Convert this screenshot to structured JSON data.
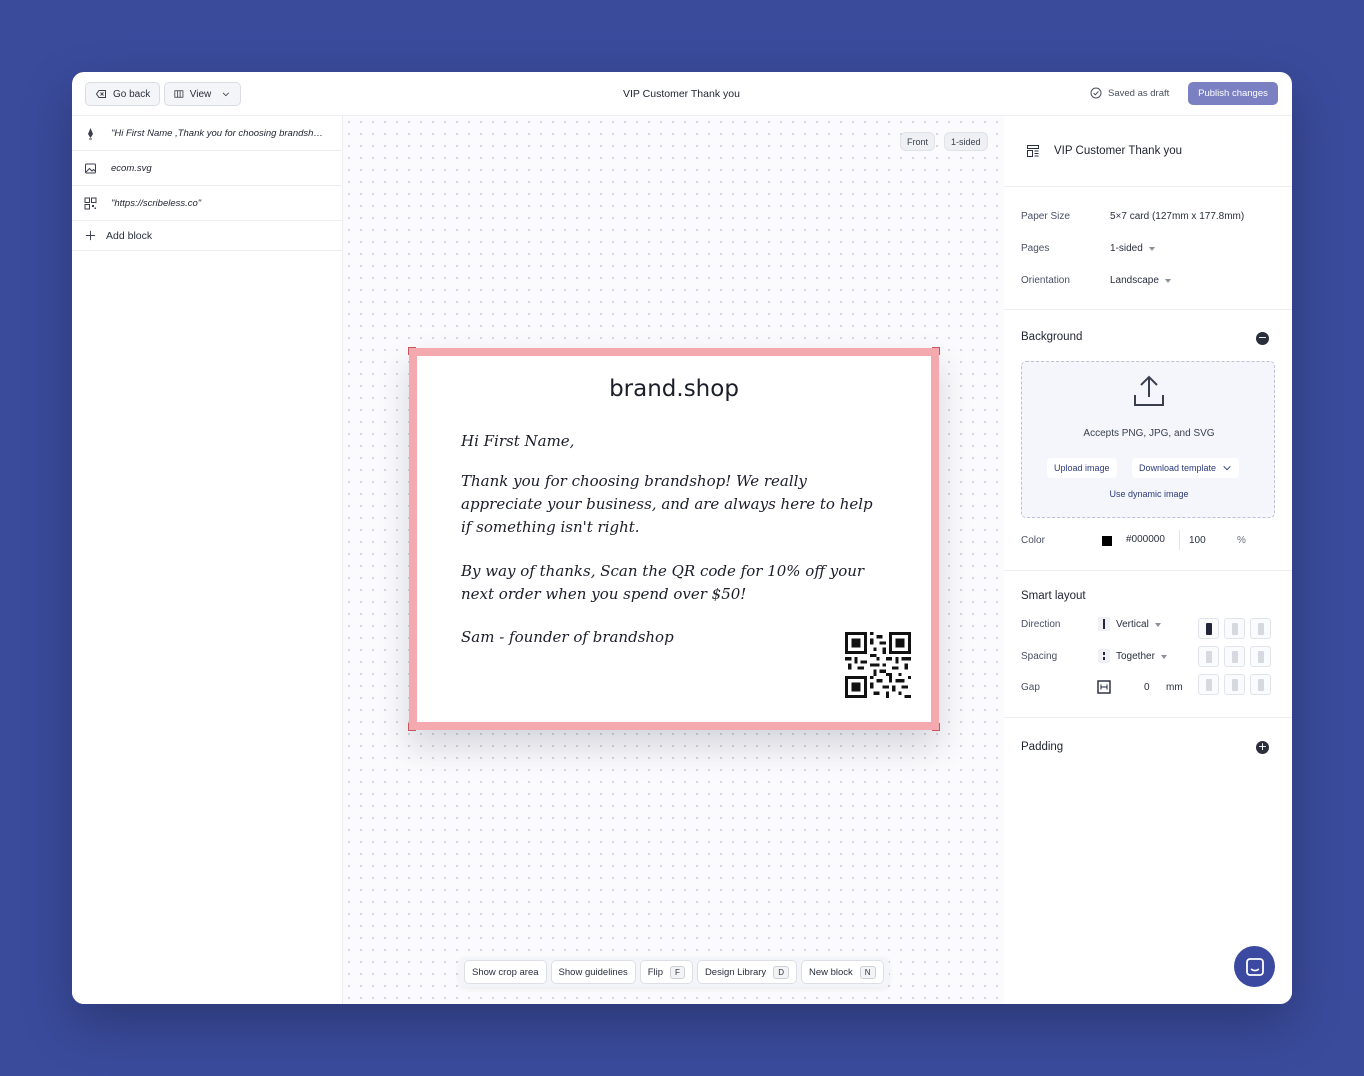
{
  "topbar": {
    "back_label": "Go back",
    "view_label": "View",
    "title": "VIP Customer Thank you",
    "saved_status": "Saved as draft",
    "publish_label": "Publish changes"
  },
  "blocks": {
    "items": [
      {
        "label": "\"Hi First Name ,Thank you for choosing brandshop! We really appreciate your business\"",
        "icon": "pen-icon"
      },
      {
        "label": "ecom.svg",
        "icon": "image-icon"
      },
      {
        "label": "\"https://scribeless.co\"",
        "icon": "qr-icon"
      }
    ],
    "add_label": "Add block"
  },
  "canvas": {
    "side_label": "Front",
    "sided_label": "1-sided",
    "card": {
      "brand": "brand.shop",
      "greeting": "Hi First Name,",
      "para1": "Thank you for choosing brandshop! We really appreciate your business, and are always here to help if something isn't right.",
      "para2": "By way of thanks, Scan the QR code for 10% off your next order when you spend over $50!",
      "signoff": "Sam - founder of brandshop",
      "border_color": "#f3a9ad"
    },
    "toolbar": {
      "crop": "Show crop area",
      "guidelines": "Show guidelines",
      "flip": "Flip",
      "flip_key": "F",
      "library": "Design Library",
      "library_key": "D",
      "new_block": "New block",
      "new_block_key": "N"
    }
  },
  "settings": {
    "title": "VIP Customer Thank you",
    "paper_size_label": "Paper Size",
    "paper_size_value": "5×7 card (127mm x 177.8mm)",
    "pages_label": "Pages",
    "pages_value": "1-sided",
    "orientation_label": "Orientation",
    "orientation_value": "Landscape",
    "background": {
      "title": "Background",
      "accepts": "Accepts PNG, JPG, and SVG",
      "upload": "Upload image",
      "download": "Download template",
      "dynamic": "Use dynamic image",
      "color_label": "Color",
      "color_value": "#000000",
      "opacity": "100",
      "opacity_unit": "%"
    },
    "smart_layout": {
      "title": "Smart layout",
      "direction_label": "Direction",
      "direction_value": "Vertical",
      "spacing_label": "Spacing",
      "spacing_value": "Together",
      "gap_label": "Gap",
      "gap_value": "0",
      "gap_unit": "mm"
    },
    "padding_title": "Padding"
  },
  "colors": {
    "background": "#3a4b9c",
    "accent": "#7b80c2",
    "card_border": "#f3a9ad"
  }
}
